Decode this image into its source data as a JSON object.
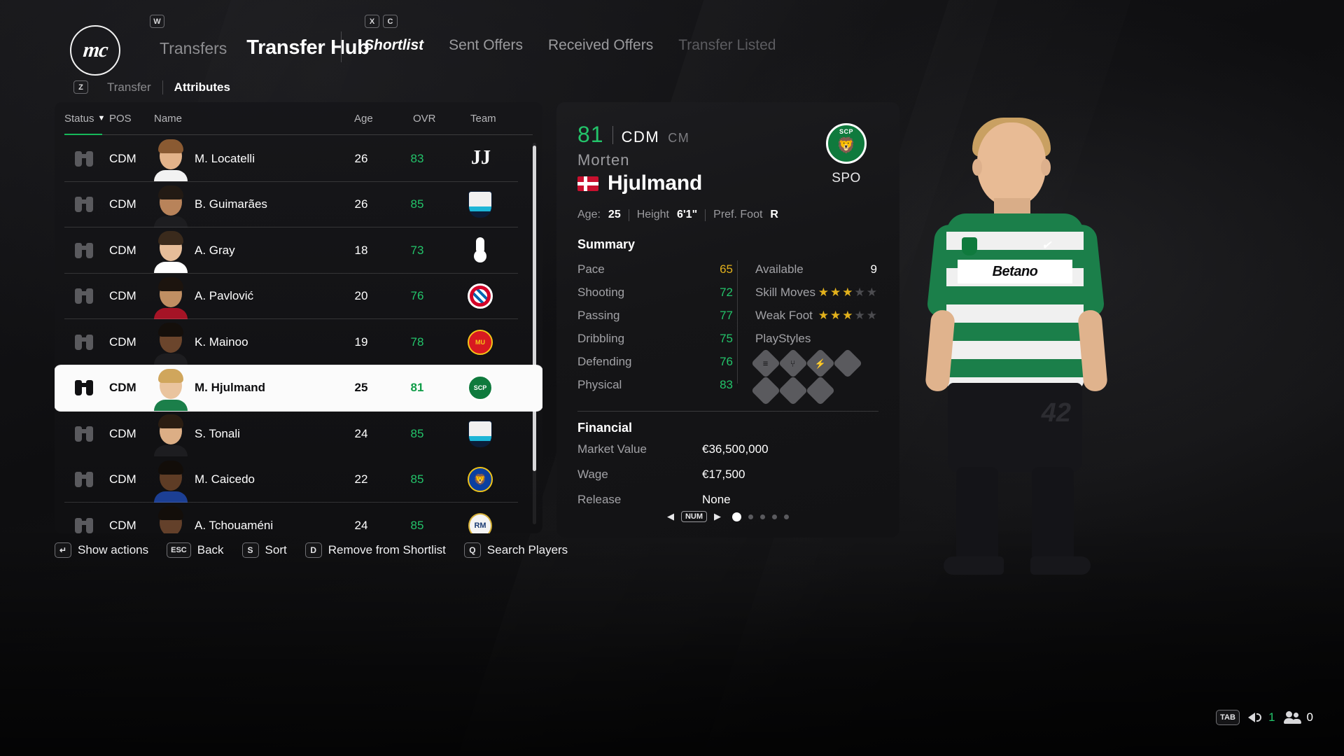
{
  "app": {
    "logo_text": "mc"
  },
  "header": {
    "breadcrumb_sub": "Transfers",
    "breadcrumb_main": "Transfer Hub",
    "key_w": "W",
    "key_x": "X",
    "key_c": "C",
    "key_z": "Z",
    "tabs": [
      {
        "label": "Shortlist",
        "state": "active"
      },
      {
        "label": "Sent Offers",
        "state": "normal"
      },
      {
        "label": "Received Offers",
        "state": "normal"
      },
      {
        "label": "Transfer Listed",
        "state": "dim"
      }
    ],
    "subtabs": [
      {
        "label": "Transfer",
        "state": "normal"
      },
      {
        "label": "Attributes",
        "state": "active"
      }
    ]
  },
  "list": {
    "columns": {
      "status": "Status",
      "sort_caret": "▼",
      "pos": "POS",
      "name": "Name",
      "age": "Age",
      "ovr": "OVR",
      "team": "Team"
    },
    "rows": [
      {
        "status_icon": "binoculars-icon",
        "pos": "CDM",
        "name": "M. Locatelli",
        "age": "26",
        "ovr": "83",
        "team": "Juventus",
        "crest": "juventus",
        "selected": false,
        "hair": "#8a5a32",
        "skin": "#e3b38a",
        "kit": "#f2f2f2"
      },
      {
        "status_icon": "binoculars-icon",
        "pos": "CDM",
        "name": "B. Guimarães",
        "age": "26",
        "ovr": "85",
        "team": "Newcastle United",
        "crest": "newcastle",
        "selected": false,
        "hair": "#221a14",
        "skin": "#b8835a",
        "kit": "#1d1d20"
      },
      {
        "status_icon": "binoculars-icon",
        "pos": "CDM",
        "name": "A. Gray",
        "age": "18",
        "ovr": "73",
        "team": "Tottenham Hotspur",
        "crest": "tottenham",
        "selected": false,
        "hair": "#3a2a1c",
        "skin": "#e6bd99",
        "kit": "#ffffff"
      },
      {
        "status_icon": "binoculars-icon",
        "pos": "CDM",
        "name": "A. Pavlović",
        "age": "20",
        "ovr": "76",
        "team": "FC Bayern München",
        "crest": "bayern",
        "selected": false,
        "hair": "#1c140e",
        "skin": "#c08f63",
        "kit": "#a51426"
      },
      {
        "status_icon": "binoculars-icon",
        "pos": "CDM",
        "name": "K. Mainoo",
        "age": "19",
        "ovr": "78",
        "team": "Manchester United",
        "crest": "manutd",
        "selected": false,
        "hair": "#140f0b",
        "skin": "#6b452c",
        "kit": "#1d1d20"
      },
      {
        "status_icon": "binoculars-icon",
        "pos": "CDM",
        "name": "M. Hjulmand",
        "age": "25",
        "ovr": "81",
        "team": "Sporting CP",
        "crest": "sporting",
        "selected": true,
        "hair": "#d0a65c",
        "skin": "#eac49e",
        "kit": "#1b7f4a"
      },
      {
        "status_icon": "binoculars-icon",
        "pos": "CDM",
        "name": "S. Tonali",
        "age": "24",
        "ovr": "85",
        "team": "Newcastle United",
        "crest": "newcastle",
        "selected": false,
        "hair": "#2a1d12",
        "skin": "#dcae85",
        "kit": "#1d1d20"
      },
      {
        "status_icon": "binoculars-icon",
        "pos": "CDM",
        "name": "M. Caicedo",
        "age": "22",
        "ovr": "85",
        "team": "Chelsea",
        "crest": "chelsea",
        "selected": false,
        "hair": "#120d09",
        "skin": "#5e3c25",
        "kit": "#1c3f94"
      },
      {
        "status_icon": "binoculars-icon",
        "pos": "CDM",
        "name": "A. Tchouaméni",
        "age": "24",
        "ovr": "85",
        "team": "Real Madrid",
        "crest": "realmadrid",
        "selected": false,
        "hair": "#130e0a",
        "skin": "#63402a",
        "kit": "#f2f2f2"
      }
    ]
  },
  "actions": [
    {
      "key": "↵",
      "label": "Show actions",
      "wide": false
    },
    {
      "key": "ESC",
      "label": "Back",
      "wide": true
    },
    {
      "key": "S",
      "label": "Sort",
      "wide": false
    },
    {
      "key": "D",
      "label": "Remove from Shortlist",
      "wide": false
    },
    {
      "key": "Q",
      "label": "Search Players",
      "wide": false
    }
  ],
  "detail": {
    "ovr": "81",
    "position": "CDM",
    "position_alt": "CM",
    "first_name": "Morten",
    "last_name": "Hjulmand",
    "nation_flag": "denmark-flag",
    "meta": {
      "age_label": "Age:",
      "age_value": "25",
      "height_label": "Height",
      "height_value": "6'1\"",
      "foot_label": "Pref. Foot",
      "foot_value": "R"
    },
    "club": {
      "crest_text": "SCP",
      "name": "SPO"
    },
    "summary_title": "Summary",
    "summary_left": [
      {
        "label": "Pace",
        "value": "65",
        "color": "gold"
      },
      {
        "label": "Shooting",
        "value": "72",
        "color": "green"
      },
      {
        "label": "Passing",
        "value": "77",
        "color": "green"
      },
      {
        "label": "Dribbling",
        "value": "75",
        "color": "green"
      },
      {
        "label": "Defending",
        "value": "76",
        "color": "green"
      },
      {
        "label": "Physical",
        "value": "83",
        "color": "green"
      }
    ],
    "summary_right": {
      "available_label": "Available",
      "available_value": "9",
      "skill_moves_label": "Skill Moves",
      "skill_moves": 3,
      "weak_foot_label": "Weak Foot",
      "weak_foot": 3,
      "playstyles_label": "PlayStyles",
      "playstyles": [
        {
          "icon": "slide-tackle-icon",
          "glyph": "≡",
          "filled": true
        },
        {
          "icon": "anticipate-icon",
          "glyph": "⑂",
          "filled": true
        },
        {
          "icon": "power-shot-icon",
          "glyph": "⚡",
          "filled": true
        },
        {
          "icon": "empty-playstyle-4",
          "glyph": "",
          "filled": false
        },
        {
          "icon": "empty-playstyle-5",
          "glyph": "",
          "filled": false
        },
        {
          "icon": "empty-playstyle-6",
          "glyph": "",
          "filled": false
        },
        {
          "icon": "empty-playstyle-7",
          "glyph": "",
          "filled": false
        }
      ]
    },
    "financial_title": "Financial",
    "financial": [
      {
        "label": "Market Value",
        "value": "€36,500,000"
      },
      {
        "label": "Wage",
        "value": "€17,500"
      },
      {
        "label": "Release",
        "value": "None"
      }
    ],
    "pager": {
      "prev": "◀",
      "next": "▶",
      "num_label": "NUM",
      "pages": 5,
      "current": 1
    }
  },
  "player_render": {
    "shirt_sponsor": "Betano",
    "shirt_number": "42",
    "brand_mark": "✔"
  },
  "status_bar": {
    "key_tab": "TAB",
    "speaker_icon": "speaker-icon",
    "speaker_count": "1",
    "people_icon": "people-icon",
    "people_count": "0"
  },
  "colors": {
    "accent_green": "#23c46a",
    "accent_gold": "#e2b11c",
    "selected_row_bg": "#fbfbfb"
  }
}
